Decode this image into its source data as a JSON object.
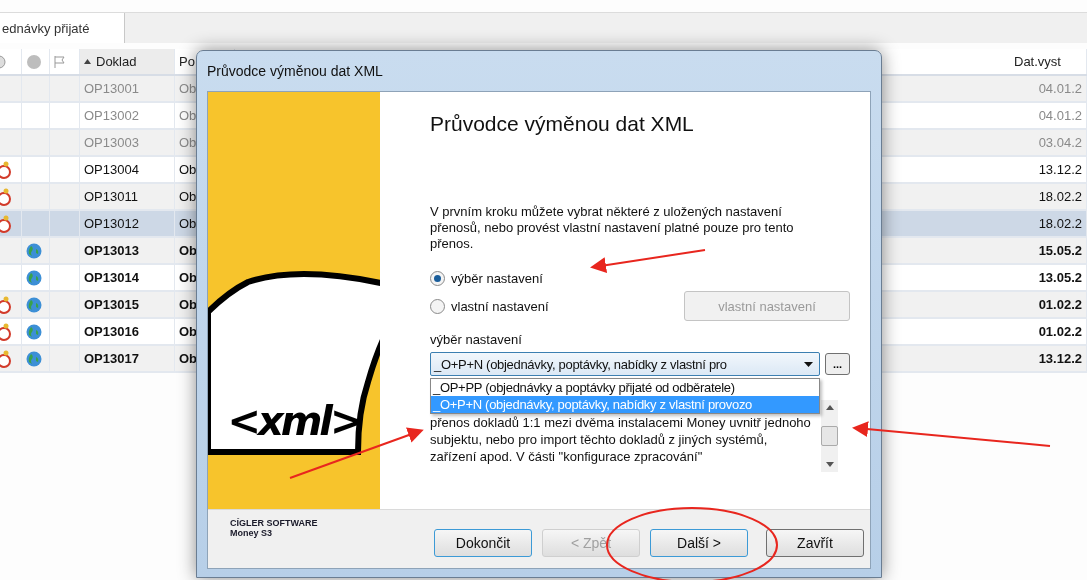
{
  "tab": {
    "label": "ednávky přijaté",
    "selected": true
  },
  "table": {
    "columns": [
      {
        "kind": "icon-alarm"
      },
      {
        "kind": "icon-globe"
      },
      {
        "kind": "icon-flag"
      },
      {
        "kind": "text",
        "label": "Doklad",
        "sorted": true
      },
      {
        "kind": "text",
        "label": "Po"
      },
      {
        "kind": "text",
        "label": "Dat.vyst"
      }
    ],
    "rows": [
      {
        "doklad": "OP13001",
        "po": "Ob",
        "date": "04.01.2",
        "greyed": true,
        "bold": false,
        "alarm": false,
        "globe": false,
        "selected": false
      },
      {
        "doklad": "OP13002",
        "po": "Ob",
        "date": "04.01.2",
        "greyed": true,
        "bold": false,
        "alarm": false,
        "globe": false,
        "selected": false
      },
      {
        "doklad": "OP13003",
        "po": "Ob",
        "date": "03.04.2",
        "greyed": true,
        "bold": false,
        "alarm": false,
        "globe": false,
        "selected": false
      },
      {
        "doklad": "OP13004",
        "po": "Ob",
        "date": "13.12.2",
        "greyed": false,
        "bold": false,
        "alarm": true,
        "globe": false,
        "selected": false
      },
      {
        "doklad": "OP13011",
        "po": "Ob",
        "date": "18.02.2",
        "greyed": false,
        "bold": false,
        "alarm": true,
        "globe": false,
        "selected": false
      },
      {
        "doklad": "OP13012",
        "po": "Ob",
        "date": "18.02.2",
        "greyed": false,
        "bold": false,
        "alarm": true,
        "globe": false,
        "selected": true
      },
      {
        "doklad": "OP13013",
        "po": "Ob",
        "date": "15.05.2",
        "greyed": false,
        "bold": true,
        "alarm": false,
        "globe": true,
        "selected": false
      },
      {
        "doklad": "OP13014",
        "po": "Ob",
        "date": "13.05.2",
        "greyed": false,
        "bold": true,
        "alarm": false,
        "globe": true,
        "selected": false
      },
      {
        "doklad": "OP13015",
        "po": "Ob",
        "date": "01.02.2",
        "greyed": false,
        "bold": true,
        "alarm": true,
        "globe": true,
        "selected": false
      },
      {
        "doklad": "OP13016",
        "po": "Ob",
        "date": "01.02.2",
        "greyed": false,
        "bold": true,
        "alarm": true,
        "globe": true,
        "selected": false
      },
      {
        "doklad": "OP13017",
        "po": "Ob",
        "date": "13.12.2",
        "greyed": false,
        "bold": true,
        "alarm": true,
        "globe": true,
        "selected": false
      }
    ]
  },
  "dialog": {
    "title": "Průvodce výměnou dat XML",
    "logo_text": "<xml>",
    "vendor": "CÍGLER SOFTWARE",
    "product": "Money S3",
    "heading": "Průvodce výměnou dat XML",
    "intro": "V prvním kroku můžete vybrat některé z uložených nastavení přenosů, nebo provést vlastní nastavení platné pouze pro tento přenos.",
    "radios": [
      {
        "label": "výběr nastavení",
        "selected": true
      },
      {
        "label": "vlastní nastavení",
        "selected": false
      }
    ],
    "custom_button": {
      "label": "vlastní nastavení",
      "disabled": true
    },
    "combo_label": "výběr nastavení",
    "combo_value": "_O+P+N (objednávky, poptávky, nabídky z vlastní pro",
    "more_button": "...",
    "options": [
      {
        "label": "_OP+PP (objednávky a poptávky přijaté od odběratele)",
        "selected": false
      },
      {
        "label": "_O+P+N (objednávky, poptávky, nabídky z vlastní provozo",
        "selected": true
      }
    ],
    "description": "přenos dokladů 1:1 mezi dvěma instalacemi Money uvnitř jednoho subjektu, nebo pro import těchto dokladů z jiných systémů, zařízení apod. V části \"konfigurace zpracování\"",
    "buttons": [
      {
        "label": "Dokončit",
        "disabled": false,
        "focused": true
      },
      {
        "label": "< Zpět",
        "disabled": true,
        "focused": false
      },
      {
        "label": "Další >",
        "disabled": false,
        "focused": true
      },
      {
        "label": "Zavřít",
        "disabled": false,
        "focused": false
      }
    ]
  }
}
